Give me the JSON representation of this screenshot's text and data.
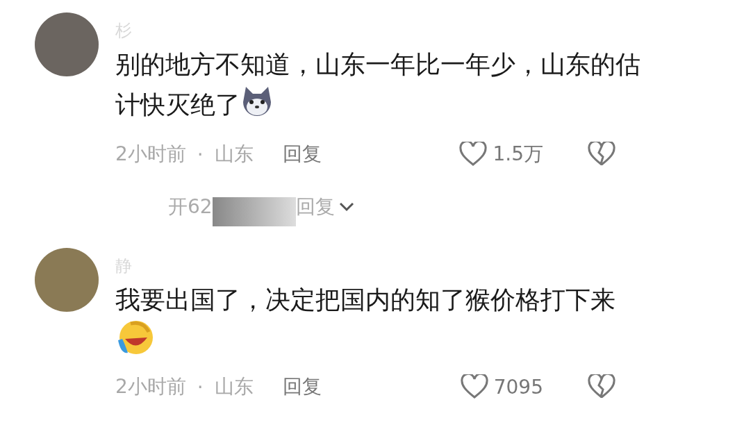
{
  "comments": [
    {
      "username": "杉",
      "text": "别的地方不知道，山东一年比一年少，山东的估计快灭绝了",
      "emoji": {
        "kind": "dog"
      },
      "time": "2小时前",
      "separator": "·",
      "location": "山东",
      "reply_label": "回复",
      "likes": "1.5万",
      "replies": {
        "prefix": "开62",
        "suffix": "回复"
      }
    },
    {
      "username": "静",
      "text": "我要出国了，决定把国内的知了猴价格打下来",
      "emoji": {
        "kind": "laugh-cry"
      },
      "time": "2小时前",
      "separator": "·",
      "location": "山东",
      "reply_label": "回复",
      "likes": "7095"
    }
  ]
}
